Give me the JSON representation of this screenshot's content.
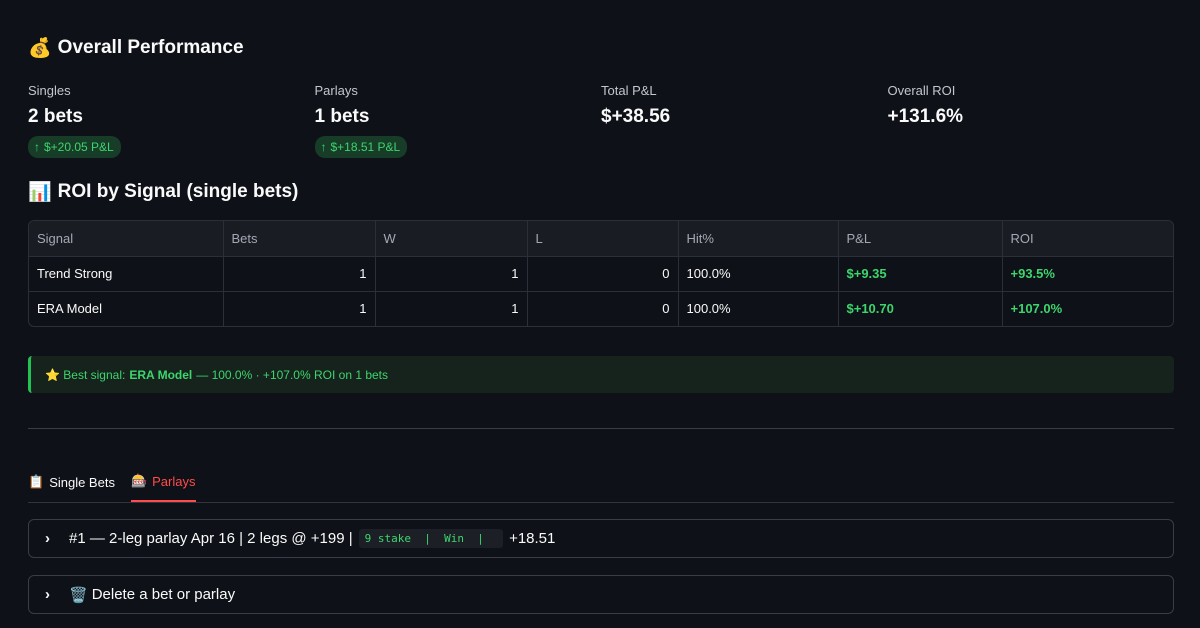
{
  "overall": {
    "icon": "money-bag-icon",
    "emoji": "💰",
    "title": "Overall Performance"
  },
  "metrics": [
    {
      "label": "Singles",
      "value": "2 bets",
      "delta": "$+20.05 P&L"
    },
    {
      "label": "Parlays",
      "value": "1 bets",
      "delta": "$+18.51 P&L"
    },
    {
      "label": "Total P&L",
      "value": "$+38.56"
    },
    {
      "label": "Overall ROI",
      "value": "+131.6%"
    }
  ],
  "roi": {
    "emoji": "📊",
    "title": "ROI by Signal (single bets)",
    "columns": [
      "Signal",
      "Bets",
      "W",
      "L",
      "Hit%",
      "P&L",
      "ROI"
    ],
    "rows": [
      [
        "Trend Strong",
        "1",
        "1",
        "0",
        "100.0%",
        "$+9.35",
        "+93.5%"
      ],
      [
        "ERA Model",
        "1",
        "1",
        "0",
        "100.0%",
        "$+10.70",
        "+107.0%"
      ]
    ]
  },
  "callout": {
    "emoji": "⭐",
    "prefix": "Best signal:",
    "signal": "ERA Model",
    "suffix": "— 100.0% · +107.0% ROI on 1 bets"
  },
  "tabs": [
    {
      "emoji": "📋",
      "label": "Single Bets",
      "active": false
    },
    {
      "emoji": "🎰",
      "label": "Parlays",
      "active": true
    }
  ],
  "expanders": {
    "parlay": {
      "label": "#1 — 2-leg parlay Apr 16 | 2 legs @ +199 |",
      "code": "9 stake  |  Win  |  ",
      "tail": "+18.51"
    },
    "delete": {
      "emoji": "🗑️",
      "label": "Delete a bet or parlay"
    }
  },
  "colors": {
    "background": "#0e1117",
    "positive": "#3dd56d",
    "accent": "#ff4b4b"
  }
}
